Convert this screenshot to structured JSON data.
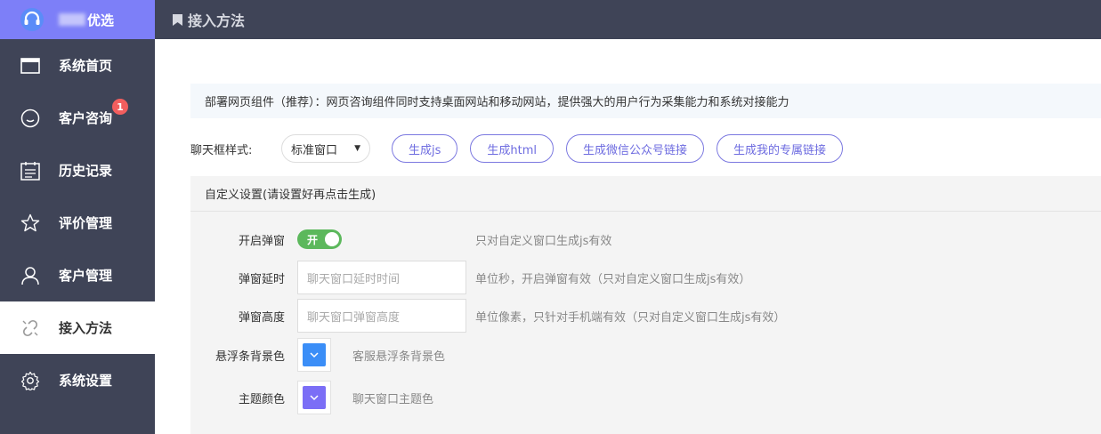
{
  "brand": {
    "name": "优选",
    "icon": "headset-icon"
  },
  "header": {
    "title": "接入方法",
    "icon": "bookmark-icon"
  },
  "sidebar": {
    "items": [
      {
        "label": "系统首页",
        "icon": "window-icon"
      },
      {
        "label": "客户咨询",
        "icon": "chat-icon",
        "badge": "1"
      },
      {
        "label": "历史记录",
        "icon": "calendar-list-icon"
      },
      {
        "label": "评价管理",
        "icon": "star-icon"
      },
      {
        "label": "客户管理",
        "icon": "user-icon"
      },
      {
        "label": "接入方法",
        "icon": "link-icon",
        "active": true
      },
      {
        "label": "系统设置",
        "icon": "gear-icon"
      }
    ]
  },
  "intro": {
    "text": "部署网页组件（推荐）：网页咨询组件同时支持桌面网站和移动网站，提供强大的用户行为采集能力和系统对接能力"
  },
  "chat_style": {
    "label": "聊天框样式:",
    "selected": "标准窗口",
    "buttons": [
      "生成js",
      "生成html",
      "生成微信公众号链接",
      "生成我的专属链接"
    ]
  },
  "custom": {
    "title": "自定义设置(请设置好再点击生成)",
    "popup": {
      "label": "开启弹窗",
      "toggle_text": "开",
      "hint": "只对自定义窗口生成js有效"
    },
    "delay": {
      "label": "弹窗延时",
      "placeholder": "聊天窗口延时时间",
      "hint": "单位秒，开启弹窗有效（只对自定义窗口生成js有效）"
    },
    "height": {
      "label": "弹窗高度",
      "placeholder": "聊天窗口弹窗高度",
      "hint": "单位像素，只针对手机端有效（只对自定义窗口生成js有效）"
    },
    "float_bg": {
      "label": "悬浮条背景色",
      "color": "#3b8ef7",
      "hint": "客服悬浮条背景色"
    },
    "theme": {
      "label": "主题颜色",
      "color": "#7b6ef6",
      "hint": "聊天窗口主题色"
    }
  },
  "colors": {
    "sidebar": "#3f4457",
    "brand": "#7d7ff8",
    "accent": "#6e6ce0",
    "toggle_on": "#5cb85c"
  }
}
